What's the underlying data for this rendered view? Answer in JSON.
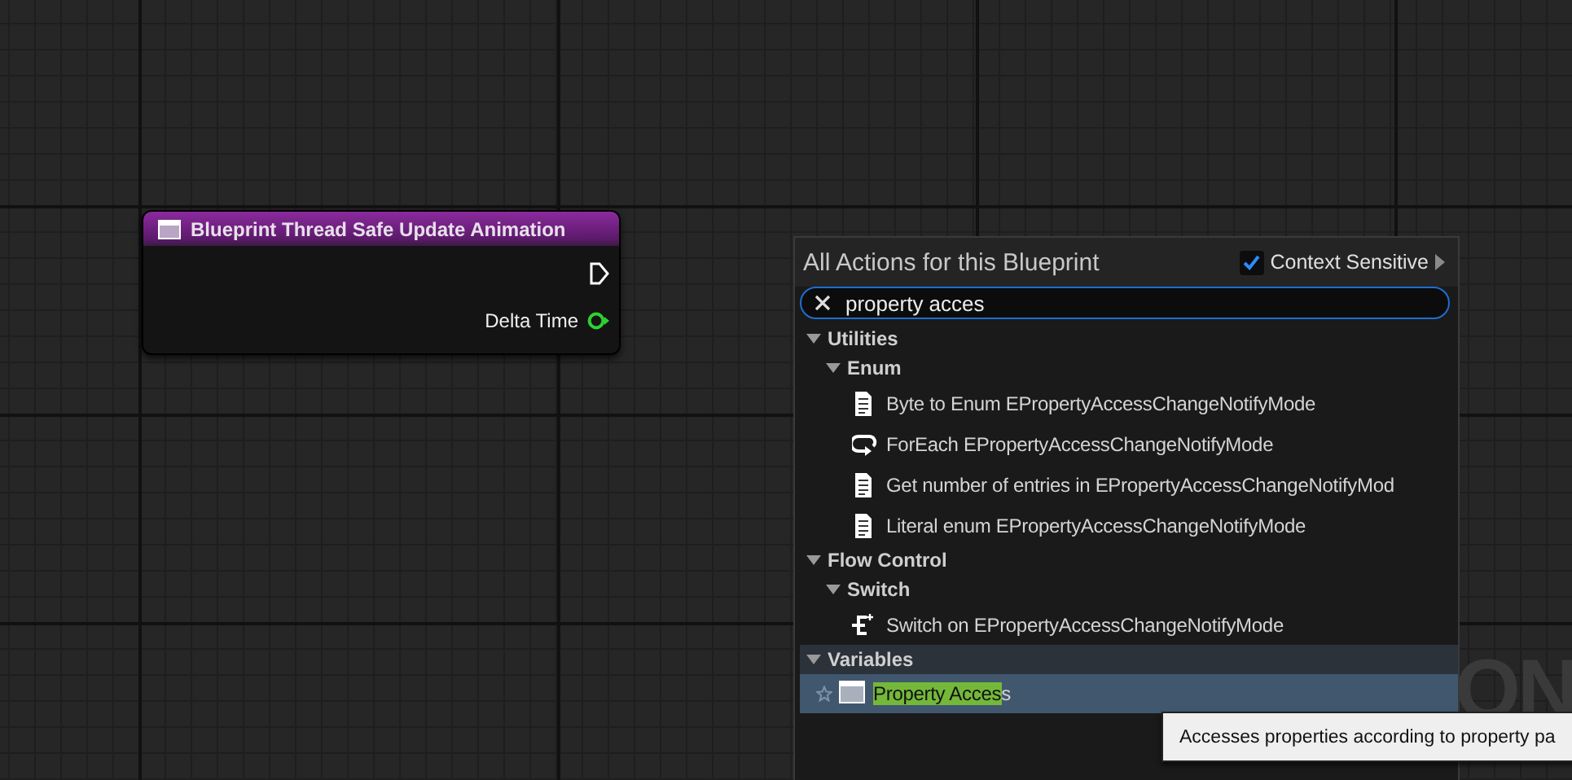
{
  "graph": {
    "watermark": "ON"
  },
  "node": {
    "title": "Blueprint Thread Safe Update Animation",
    "pins": [
      {
        "kind": "exec"
      },
      {
        "kind": "float",
        "label": "Delta Time",
        "color": "#2fd12f"
      }
    ]
  },
  "menu": {
    "title": "All Actions for this Blueprint",
    "context_sensitive": {
      "label": "Context Sensitive",
      "checked": true
    },
    "search": {
      "value": "property acces"
    },
    "tree": [
      {
        "kind": "category",
        "label": "Utilities",
        "expanded": true,
        "hovered": false,
        "children": [
          {
            "kind": "category",
            "label": "Enum",
            "expanded": true,
            "hovered": false,
            "children": [
              {
                "kind": "document",
                "label": "Byte to Enum EPropertyAccessChangeNotifyMode",
                "selected": false
              },
              {
                "kind": "loop",
                "label": "ForEach EPropertyAccessChangeNotifyMode",
                "selected": false
              },
              {
                "kind": "document",
                "label": "Get number of entries in EPropertyAccessChangeNotifyMod",
                "selected": false
              },
              {
                "kind": "document",
                "label": "Literal enum EPropertyAccessChangeNotifyMode",
                "selected": false
              }
            ]
          }
        ]
      },
      {
        "kind": "category",
        "label": "Flow Control",
        "expanded": true,
        "hovered": false,
        "children": [
          {
            "kind": "category",
            "label": "Switch",
            "expanded": true,
            "hovered": false,
            "children": [
              {
                "kind": "switch",
                "label": "Switch on EPropertyAccessChangeNotifyMode",
                "selected": false
              }
            ]
          }
        ]
      },
      {
        "kind": "category",
        "label": "Variables",
        "expanded": true,
        "hovered": true,
        "children": [
          {
            "kind": "variable",
            "favorite": false,
            "label_parts": [
              {
                "text": "Property Acces",
                "highlighted": true
              },
              {
                "text": "s",
                "highlighted": false
              }
            ],
            "selected": true
          }
        ]
      }
    ]
  },
  "tooltip": {
    "text": "Accesses properties according to property pa"
  }
}
